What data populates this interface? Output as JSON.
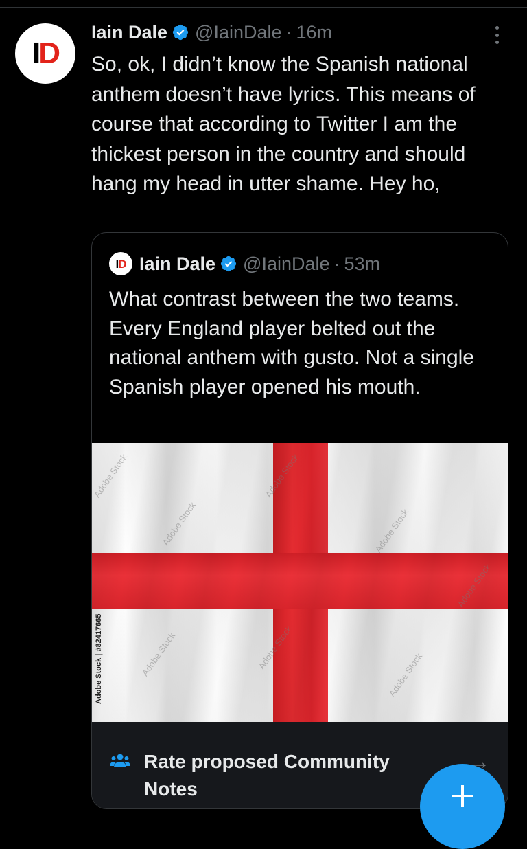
{
  "tweet": {
    "author": {
      "name": "Iain Dale",
      "handle": "@IainDale",
      "avatar_text": [
        "I",
        "D"
      ]
    },
    "separator": "·",
    "time": "16m",
    "text": "So, ok, I didn’t know the Spanish national anthem doesn’t have lyrics. This means of course that according to Twitter I am the thickest person in the country and should hang my head in utter shame. Hey ho,"
  },
  "quote": {
    "author": {
      "name": "Iain Dale",
      "handle": "@IainDale",
      "avatar_text": [
        "I",
        "D"
      ]
    },
    "separator": "·",
    "time": "53m",
    "text": "What contrast between the two teams. Every England player belted out the national anthem with gusto. Not a single Spanish player opened his mouth.",
    "image": {
      "side_watermark": "Adobe Stock | #82417665",
      "watermark": "Adobe Stock"
    }
  },
  "community_notes": {
    "label": "Rate proposed Community Notes",
    "arrow": "→"
  },
  "icons": {
    "verified": "verified-badge-icon",
    "more": "more-vertical-icon",
    "people": "people-icon",
    "compose": "plus-icon"
  },
  "colors": {
    "accent": "#1d9bf0",
    "background": "#000000",
    "muted": "#71767b",
    "flag_red": "#e62c31"
  }
}
